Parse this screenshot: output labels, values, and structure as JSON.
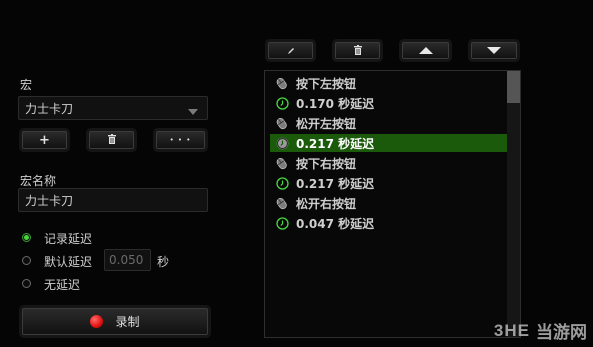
{
  "macro_panel": {
    "macro_label": "宏",
    "macro_select_value": "力士卡刀",
    "add_label": "+",
    "delete_icon": "trash-icon",
    "more_label": "• • •",
    "name_label": "宏名称",
    "name_value": "力士卡刀",
    "delay_options": [
      {
        "label": "记录延迟",
        "selected": true
      },
      {
        "label": "默认延迟",
        "selected": false
      },
      {
        "label": "无延迟",
        "selected": false
      }
    ],
    "default_delay_value": "0.050",
    "default_delay_unit": "秒",
    "record_label": "录制",
    "record_color": "#e01010"
  },
  "toolbar": {
    "edit_icon": "pencil-icon",
    "delete_icon": "trash-icon",
    "up_icon": "arrow-up-icon",
    "down_icon": "arrow-down-icon"
  },
  "events": [
    {
      "type": "mouse",
      "text": "按下左按钮",
      "selected": false
    },
    {
      "type": "delay",
      "text": "0.170 秒延迟",
      "selected": false
    },
    {
      "type": "mouse",
      "text": "松开左按钮",
      "selected": false
    },
    {
      "type": "delay",
      "text": "0.217 秒延迟",
      "selected": true
    },
    {
      "type": "mouse",
      "text": "按下右按钮",
      "selected": false
    },
    {
      "type": "delay",
      "text": "0.217 秒延迟",
      "selected": false
    },
    {
      "type": "mouse",
      "text": "松开右按钮",
      "selected": false
    },
    {
      "type": "delay",
      "text": "0.047 秒延迟",
      "selected": false
    }
  ],
  "watermark": {
    "logo_text": "3HE",
    "site_text": "当游网"
  },
  "colors": {
    "accent_green": "#45d83d",
    "selected_row": "#1b5a0b"
  }
}
